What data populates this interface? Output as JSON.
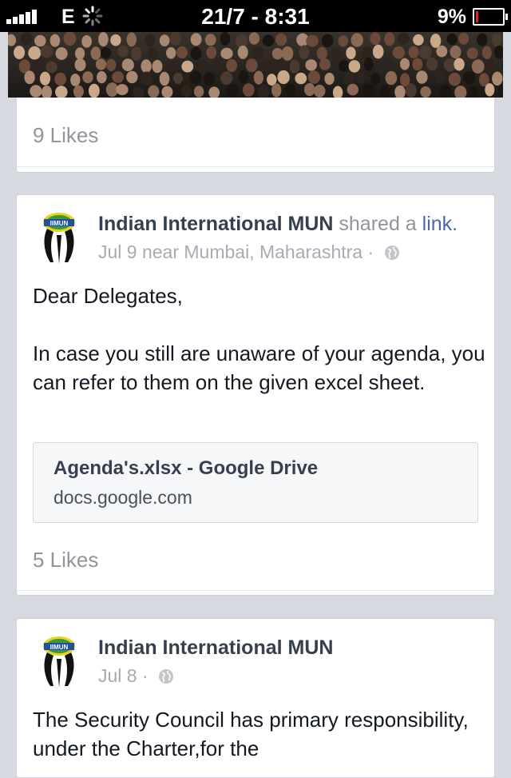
{
  "status_bar": {
    "carrier": "E",
    "time": "21/7 - 8:31",
    "battery_percent": "9%",
    "battery_level": 0.09,
    "signal_bars": 5
  },
  "feed": {
    "prev_post": {
      "likes": "9 Likes"
    },
    "posts": [
      {
        "author": "Indian International MUN",
        "verb": "shared a",
        "link_word": "link.",
        "date": "Jul 9 near Mumbai, Maharashtra",
        "separator": "·",
        "privacy_icon": "globe-icon",
        "text_greeting": "Dear Delegates,",
        "text_body": "In case you still are unaware of your agenda, you can refer to them on the given excel sheet.",
        "link_title": "Agenda's.xlsx - Google Drive",
        "link_domain": "docs.google.com",
        "likes": "5 Likes"
      },
      {
        "author": "Indian International MUN",
        "date": "Jul 8",
        "separator": "·",
        "privacy_icon": "globe-icon",
        "text": "The Security Council has primary responsibility, under the Charter,for the"
      }
    ]
  },
  "colors": {
    "background": "#d6d9df",
    "author": "#373e4d",
    "link": "#4a67a8",
    "meta": "#90949c",
    "battery_low": "#e0202a"
  }
}
